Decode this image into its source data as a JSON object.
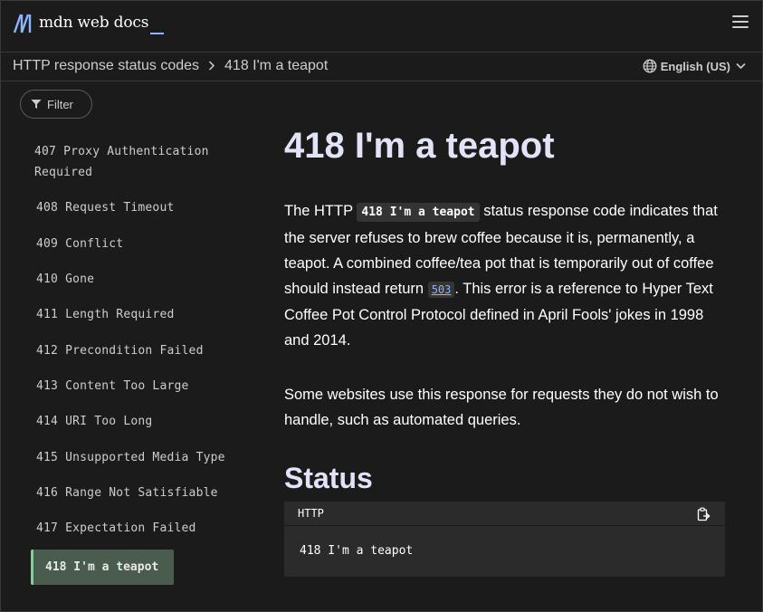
{
  "header": {
    "logo_text": "mdn web docs"
  },
  "breadcrumb": {
    "parent": "HTTP response status codes",
    "current": "418 I'm a teapot"
  },
  "language": {
    "label": "English (US)"
  },
  "filter": {
    "label": "Filter"
  },
  "sidebar": {
    "items": [
      {
        "label": "407 Proxy Authentication Required"
      },
      {
        "label": "408 Request Timeout"
      },
      {
        "label": "409 Conflict"
      },
      {
        "label": "410 Gone"
      },
      {
        "label": "411 Length Required"
      },
      {
        "label": "412 Precondition Failed"
      },
      {
        "label": "413 Content Too Large"
      },
      {
        "label": "414 URI Too Long"
      },
      {
        "label": "415 Unsupported Media Type"
      },
      {
        "label": "416 Range Not Satisfiable"
      },
      {
        "label": "417 Expectation Failed"
      }
    ],
    "active": "418 I'm a teapot"
  },
  "main": {
    "title": "418 I'm a teapot",
    "intro": {
      "before": "The HTTP ",
      "code": "418 I'm a teapot",
      "middle": " status response code indicates that the server refuses to brew coffee because it is, permanently, a teapot. A combined coffee/tea pot that is temporarily out of coffee should instead return ",
      "link": "503",
      "after": ". This error is a reference to Hyper Text Coffee Pot Control Protocol defined in April Fools' jokes in 1998 and 2014."
    },
    "para2": "Some websites use this response for requests they do not wish to handle, such as automated queries.",
    "status_heading": "Status",
    "code_block": {
      "language": "HTTP",
      "content": "418 I'm a teapot"
    }
  },
  "colors": {
    "background": "#1b1b1b",
    "heading": "#e2e2f8",
    "link": "#8cb4ff",
    "sidebar_active_bg": "#4a5c4d",
    "sidebar_active_border": "#8fc7a1"
  }
}
